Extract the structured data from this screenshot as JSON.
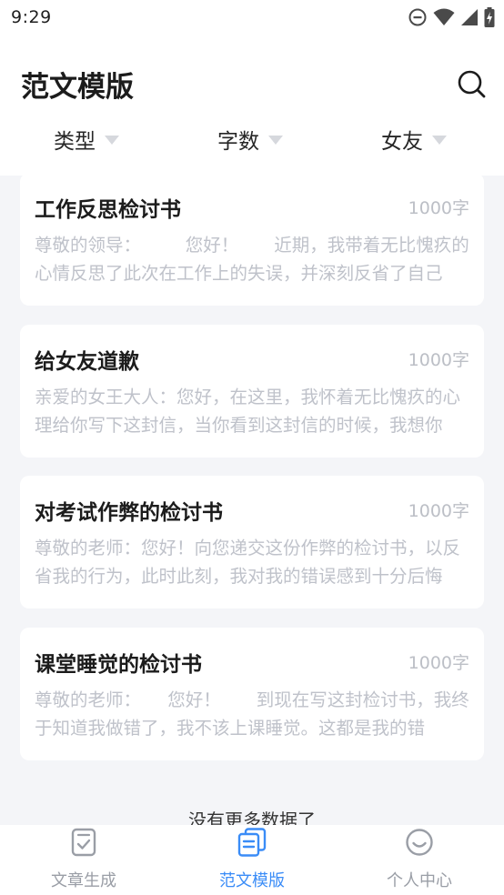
{
  "status_bar": {
    "time": "9:29",
    "icons": [
      "do-not-disturb-icon",
      "wifi-icon",
      "cellular-signal-icon",
      "battery-charging-icon"
    ]
  },
  "header": {
    "title": "范文模版",
    "search_icon": "search-icon",
    "filters": [
      {
        "label": "类型"
      },
      {
        "label": "字数"
      },
      {
        "label": "女友"
      }
    ]
  },
  "articles": [
    {
      "title": "工作反思检讨书",
      "count": "1000字",
      "excerpt": "尊敬的领导：　　　您好！　　近期，我带着无比愧疚的心情反思了此次在工作上的失误，并深刻反省了自己"
    },
    {
      "title": "给女友道歉",
      "count": "1000字",
      "excerpt": "亲爱的女王大人：您好，在这里，我怀着无比愧疚的心理给你写下这封信，当你看到这封信的时候，我想你"
    },
    {
      "title": "对考试作弊的检讨书",
      "count": "1000字",
      "excerpt": "尊敬的老师：您好！向您递交这份作弊的检讨书，以反省我的行为，此时此刻，我对我的错误感到十分后悔"
    },
    {
      "title": "课堂睡觉的检讨书",
      "count": "1000字",
      "excerpt": "尊敬的老师：　　您好！　　到现在写这封检讨书，我终于知道我做错了，我不该上课睡觉。这都是我的错"
    }
  ],
  "list_end_text": "没有更多数据了",
  "tabbar": {
    "active_color": "#3a8cf7",
    "inactive_color": "#9a9ea6",
    "tabs": [
      {
        "label": "文章生成",
        "icon": "document-check-icon",
        "active": false
      },
      {
        "label": "范文模版",
        "icon": "templates-icon",
        "active": true
      },
      {
        "label": "个人中心",
        "icon": "smiley-face-icon",
        "active": false
      }
    ]
  }
}
